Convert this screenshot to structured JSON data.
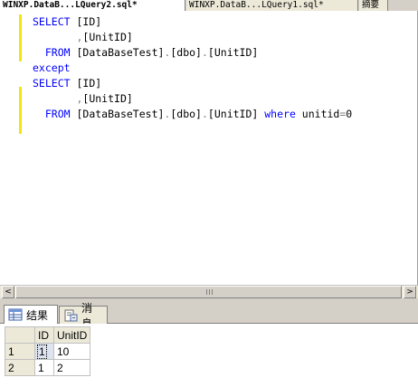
{
  "document_tabs": [
    {
      "label": "WINXP.DataB...LQuery2.sql*",
      "active": true
    },
    {
      "label": "WINXP.DataB...LQuery1.sql*",
      "active": false
    },
    {
      "label": "摘要",
      "active": false
    }
  ],
  "editor": {
    "lines": [
      {
        "indent": "",
        "parts": [
          {
            "t": "SELECT",
            "c": "kw"
          },
          {
            "t": " [ID]",
            "c": "obj"
          }
        ]
      },
      {
        "indent": "       ",
        "parts": [
          {
            "t": ",",
            "c": "gray"
          },
          {
            "t": "[UnitID]",
            "c": "obj"
          }
        ]
      },
      {
        "indent": "  ",
        "parts": [
          {
            "t": "FROM",
            "c": "kw"
          },
          {
            "t": " [DataBaseTest]",
            "c": "obj"
          },
          {
            "t": ".",
            "c": "gray"
          },
          {
            "t": "[dbo]",
            "c": "obj"
          },
          {
            "t": ".",
            "c": "gray"
          },
          {
            "t": "[UnitID]",
            "c": "obj"
          }
        ]
      },
      {
        "indent": "",
        "parts": [
          {
            "t": "except",
            "c": "kw"
          }
        ]
      },
      {
        "indent": "",
        "parts": [
          {
            "t": "SELECT",
            "c": "kw"
          },
          {
            "t": " [ID]",
            "c": "obj"
          }
        ]
      },
      {
        "indent": "       ",
        "parts": [
          {
            "t": ",",
            "c": "gray"
          },
          {
            "t": "[UnitID]",
            "c": "obj"
          }
        ]
      },
      {
        "indent": "  ",
        "parts": [
          {
            "t": "FROM",
            "c": "kw"
          },
          {
            "t": " [DataBaseTest]",
            "c": "obj"
          },
          {
            "t": ".",
            "c": "gray"
          },
          {
            "t": "[dbo]",
            "c": "obj"
          },
          {
            "t": ".",
            "c": "gray"
          },
          {
            "t": "[UnitID]",
            "c": "obj"
          },
          {
            "t": " ",
            "c": "obj"
          },
          {
            "t": "where",
            "c": "kw"
          },
          {
            "t": " unitid",
            "c": "obj"
          },
          {
            "t": "=",
            "c": "gray"
          },
          {
            "t": "0",
            "c": "obj"
          }
        ]
      }
    ]
  },
  "scrollbar": {
    "left_arrow": "<",
    "right_arrow": ">"
  },
  "result_tabs": [
    {
      "label": "结果",
      "icon": "grid-icon",
      "active": true
    },
    {
      "label": "消息",
      "icon": "message-icon",
      "active": false
    }
  ],
  "results_grid": {
    "columns": [
      "ID",
      "UnitID"
    ],
    "rows": [
      {
        "row_number": "1",
        "cells": [
          "1",
          "10"
        ],
        "selected_cell": 0
      },
      {
        "row_number": "2",
        "cells": [
          "1",
          "2"
        ]
      }
    ]
  },
  "colors": {
    "keyword": "#0000ff",
    "operator": "#808080",
    "modified_line_marker": "#f1e60f",
    "chrome": "#d4d0c8"
  }
}
